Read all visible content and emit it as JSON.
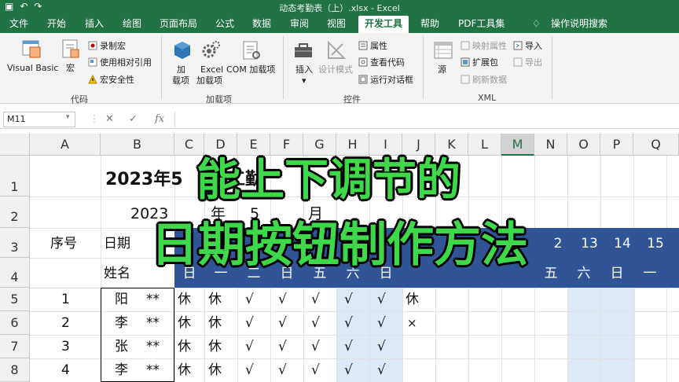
{
  "titlebar": {
    "title": "动态考勤表（上）.xlsx  -  Excel"
  },
  "menu": {
    "tabs": [
      "文件",
      "开始",
      "插入",
      "绘图",
      "页面布局",
      "公式",
      "数据",
      "审阅",
      "视图",
      "开发工具",
      "帮助",
      "PDF工具集"
    ],
    "active": "开发工具",
    "search_placeholder": "操作说明搜索"
  },
  "ribbon": {
    "code": {
      "group_label": "代码",
      "visual_basic": "Visual Basic",
      "macro": "宏",
      "record_macro": "录制宏",
      "relative_ref": "使用相对引用",
      "macro_security": "宏安全性"
    },
    "addins": {
      "group_label": "加载项",
      "addin_l1": "加",
      "addin_l2": "载项",
      "excel_l1": "Excel",
      "excel_l2": "加载项",
      "com": "COM 加载项"
    },
    "controls": {
      "group_label": "控件",
      "insert": "插入",
      "design_mode": "设计模式",
      "properties": "属性",
      "view_code": "查看代码",
      "run_dialog": "运行对话框"
    },
    "xml": {
      "group_label": "XML",
      "source": "源",
      "map_props": "映射属性",
      "expansion": "扩展包",
      "refresh": "刷新数据",
      "import": "导入",
      "export": "导出"
    }
  },
  "formula_bar": {
    "name_box": "M11",
    "cancel": "✕",
    "enter": "✓",
    "fx": "fx",
    "value": ""
  },
  "grid": {
    "columns": [
      "A",
      "B",
      "C",
      "D",
      "E",
      "F",
      "G",
      "H",
      "I",
      "J",
      "K",
      "L",
      "M",
      "N",
      "O",
      "P",
      "Q"
    ],
    "selected_column": "M",
    "rows": [
      "1",
      "2",
      "3",
      "4",
      "5",
      "6",
      "7",
      "8"
    ],
    "title_text": "2023年5",
    "title_suffix": "门工勤",
    "year": "2023",
    "year_label": "年",
    "month": "5",
    "month_label": "月",
    "seq_header": "序号",
    "date_header": "日期",
    "name_header": "姓名",
    "day_numbers": {
      "l": "2",
      "m": "13",
      "n": "14",
      "o": "15"
    },
    "weekdays": {
      "c": "日",
      "d": "一",
      "e": "二",
      "f": "日",
      "g": "五",
      "h": "六",
      "i": "日",
      "l": "五",
      "o": "六",
      "p": "日",
      "q": "一"
    },
    "staff": [
      {
        "no": "1",
        "name": "阳",
        "mask": "**",
        "marks": [
          "休",
          "休",
          "√",
          "√",
          "√",
          "√",
          "√",
          "休"
        ]
      },
      {
        "no": "2",
        "name": "李",
        "mask": "**",
        "marks": [
          "休",
          "休",
          "√",
          "√",
          "√",
          "√",
          "√",
          "×"
        ]
      },
      {
        "no": "3",
        "name": "张",
        "mask": "**",
        "marks": [
          "休",
          "休",
          "√",
          "√",
          "√",
          "√",
          "√",
          ""
        ]
      },
      {
        "no": "4",
        "name": "李",
        "mask": "**",
        "marks": [
          "休",
          "休",
          "√",
          "√",
          "√",
          "√",
          "√",
          ""
        ]
      }
    ]
  },
  "overlay": {
    "line1": "能上下调节的",
    "line2": "日期按钮制作方法"
  },
  "colors": {
    "excel_green": "#217346",
    "header_blue": "#2f5597",
    "weekend_blue": "#dde9f7",
    "caption_green": "#3ed84a"
  }
}
